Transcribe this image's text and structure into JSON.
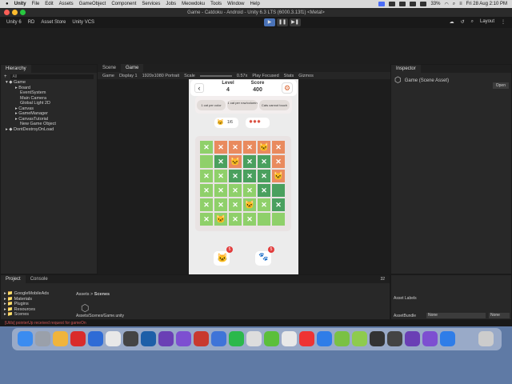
{
  "menubar": {
    "app": "Unity",
    "items": [
      "File",
      "Edit",
      "Assets",
      "GameObject",
      "Component",
      "Services",
      "Jobs",
      "Meowdoku",
      "Tools",
      "Window",
      "Help"
    ],
    "battery": "33%",
    "datetime": "Fri 28 Aug  2:10 PM"
  },
  "window": {
    "title": "Game - Catdoku - Android - Unity 6.3 LTS (6000.3.13f1) <Metal>"
  },
  "toolbar": {
    "unity": "Unity 6",
    "account": "RD",
    "asset_store": "Asset Store",
    "vcs": "Unity VCS",
    "layout": "Layout"
  },
  "hierarchy": {
    "tab": "Hierarchy",
    "search": "All",
    "root": "Game",
    "items": [
      "Board",
      "EventSystem",
      "Main Camera",
      "Global Light 2D",
      "Canvas",
      "GameManager",
      "CanvasTutorial",
      "New Game Object"
    ],
    "ddol": "DontDestroyOnLoad"
  },
  "tabs": {
    "scene": "Scene",
    "game": "Game"
  },
  "gametool": {
    "game": "Game",
    "display": "Display 1",
    "resolution": "1920x1080 Portrait",
    "scale_label": "Scale",
    "scale": "0.57x",
    "play": "Play Focused",
    "stats": "Stats",
    "gizmos": "Gizmos"
  },
  "game": {
    "level_label": "Level",
    "level": "4",
    "score_label": "Score",
    "score": "400",
    "rules": [
      "1 cat per color",
      "1 cat per row/column",
      "Cats cannot touch"
    ],
    "cat_count": "1/6",
    "badge_left": "5",
    "badge_right": "5",
    "grid": [
      [
        "g",
        "o",
        "o",
        "o",
        "o",
        "o"
      ],
      [
        "g",
        "d",
        "o",
        "d",
        "d",
        "o"
      ],
      [
        "g",
        "g",
        "d",
        "d",
        "d",
        "o"
      ],
      [
        "g",
        "g",
        "g",
        "g",
        "d",
        "d"
      ],
      [
        "g",
        "g",
        "g",
        "g",
        "g",
        "d"
      ],
      [
        "g",
        "g",
        "g",
        "g",
        "g",
        "g"
      ]
    ],
    "marks": [
      [
        "x",
        "x",
        "x",
        "x",
        "cat",
        "x"
      ],
      [
        "",
        "x",
        "cat",
        "x",
        "x",
        "x"
      ],
      [
        "x",
        "x",
        "x",
        "x",
        "x",
        "cat"
      ],
      [
        "x",
        "x",
        "x",
        "x",
        "x",
        ""
      ],
      [
        "x",
        "x",
        "x",
        "cat",
        "x",
        "x"
      ],
      [
        "x",
        "cat",
        "x",
        "x",
        "",
        ""
      ]
    ]
  },
  "inspector": {
    "tab": "Inspector",
    "title": "Game (Scene Asset)",
    "open": "Open",
    "asset_labels": "Asset Labels",
    "asset_bundle": "AssetBundle",
    "none1": "None",
    "none2": "None"
  },
  "project": {
    "tab": "Project",
    "console": "Console",
    "folders": [
      "GoogleMobileAds",
      "Materials",
      "Plugins",
      "Resources",
      "Scenes"
    ],
    "breadcrumb_root": "Assets",
    "breadcrumb_leaf": "Scenes",
    "path": "Assets/Scenes/Game.unity",
    "count": "32"
  },
  "status": {
    "text": "[Utils] pointerUp received request for gameOn"
  }
}
